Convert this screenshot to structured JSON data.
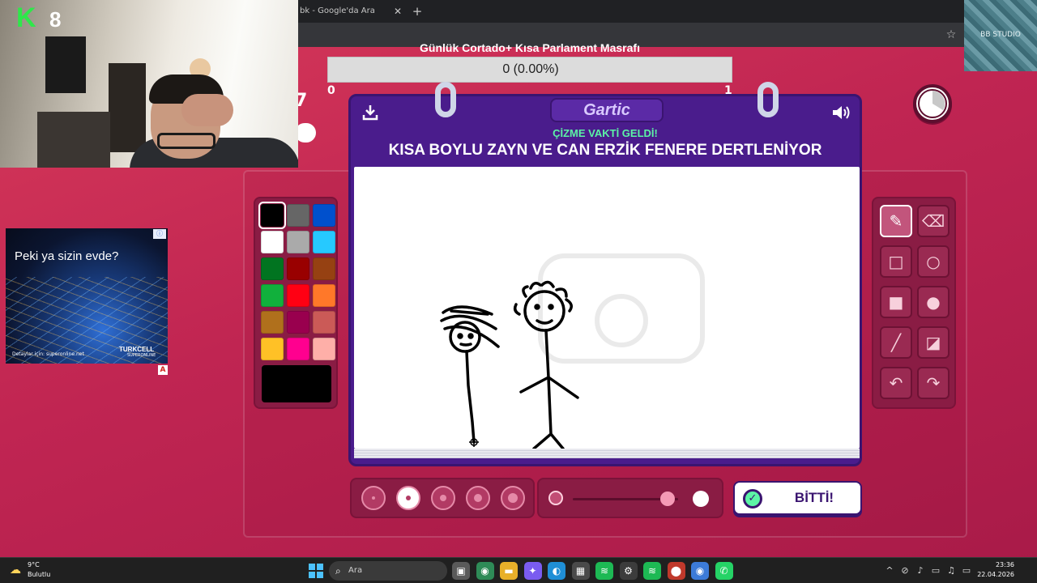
{
  "browser": {
    "tab_title": "bk - Google'da Ara",
    "close_glyph": "✕",
    "new_tab_glyph": "+",
    "star_glyph": "☆"
  },
  "overlay": {
    "k_logo": "K",
    "k_count": "8",
    "watermark": "BB STUDIO"
  },
  "progress": {
    "title": "Günlük Cortado+ Kısa Parlament Masrafı",
    "value_text": "0 (0.00%)",
    "min_label": "0",
    "max_label": "1",
    "fraction": 0
  },
  "game": {
    "brand": "Gartic",
    "subtitle": "ÇİZME VAKTİ GELDİ!",
    "prompt": "KISA BOYLU ZAYN VE CAN ERZİK FENERE DERTLENİYOR",
    "download_icon": "download-icon",
    "sound_icon": "speaker-icon",
    "done_label": "BİTTİ!",
    "done_icon_glyph": "✓",
    "left_digit": "7"
  },
  "palette": {
    "colors": [
      "#000000",
      "#666666",
      "#0050cd",
      "#ffffff",
      "#aaaaaa",
      "#26c9ff",
      "#017420",
      "#990000",
      "#964112",
      "#11b03c",
      "#ff0013",
      "#ff7829",
      "#b0701c",
      "#99004e",
      "#cb5a57",
      "#ffc126",
      "#ff008f",
      "#feafa8"
    ],
    "selected": "#000000",
    "current": "#000000"
  },
  "tools": [
    {
      "name": "pencil-tool",
      "glyph": "✎",
      "active": true
    },
    {
      "name": "eraser-tool",
      "glyph": "⌫",
      "active": false
    },
    {
      "name": "rect-outline-tool",
      "glyph": "□",
      "active": false
    },
    {
      "name": "ellipse-outline-tool",
      "glyph": "○",
      "active": false
    },
    {
      "name": "rect-fill-tool",
      "glyph": "■",
      "active": false
    },
    {
      "name": "ellipse-fill-tool",
      "glyph": "●",
      "active": false
    },
    {
      "name": "line-tool",
      "glyph": "╱",
      "active": false
    },
    {
      "name": "fill-bucket-tool",
      "glyph": "◪",
      "active": false
    },
    {
      "name": "undo-tool",
      "glyph": "↶",
      "active": false
    },
    {
      "name": "redo-tool",
      "glyph": "↷",
      "active": false
    }
  ],
  "brush_sizes": [
    {
      "level": 1,
      "active": false
    },
    {
      "level": 2,
      "active": true
    },
    {
      "level": 3,
      "active": false
    },
    {
      "level": 4,
      "active": false
    },
    {
      "level": 5,
      "active": false
    }
  ],
  "opacity": {
    "value": 0.9
  },
  "ad": {
    "title": "Peki ya sizin evde?",
    "footnote": "Detaylar için: superonline.net",
    "brand": "TURKCELL",
    "brand_sub": "SUPERONLINE",
    "info_glyph": "ⓘ",
    "badge": "A"
  },
  "taskbar": {
    "weather_temp": "9°C",
    "weather_desc": "Bulutlu",
    "search_placeholder": "Ara",
    "time": "23:36",
    "date": "22.04.2026",
    "apps": [
      {
        "name": "task-view-icon",
        "glyph": "▣",
        "color": "#5a5a5a"
      },
      {
        "name": "chrome-icon",
        "glyph": "◉",
        "color": "#2e8b57"
      },
      {
        "name": "file-explorer-icon",
        "glyph": "▬",
        "color": "#e8b02a"
      },
      {
        "name": "copilot-icon",
        "glyph": "✦",
        "color": "#7a5cf0"
      },
      {
        "name": "edge-icon",
        "glyph": "◐",
        "color": "#1f8fd6"
      },
      {
        "name": "store-icon",
        "glyph": "▦",
        "color": "#4a4a4a"
      },
      {
        "name": "spotify-icon",
        "glyph": "≋",
        "color": "#1db954"
      },
      {
        "name": "steam-icon",
        "glyph": "⚙",
        "color": "#3c3c3c"
      },
      {
        "name": "spotify-alt-icon",
        "glyph": "≋",
        "color": "#1db954"
      },
      {
        "name": "recorder-icon",
        "glyph": "⬤",
        "color": "#c0392b"
      },
      {
        "name": "chrome-active-icon",
        "glyph": "◉",
        "color": "#3c7bd8"
      },
      {
        "name": "whatsapp-icon",
        "glyph": "✆",
        "color": "#25d366"
      }
    ],
    "tray": [
      {
        "name": "chevron-up-icon",
        "glyph": "^"
      },
      {
        "name": "meet-icon",
        "glyph": "⊘"
      },
      {
        "name": "microphone-icon",
        "glyph": "♪"
      },
      {
        "name": "monitor-icon",
        "glyph": "▭"
      },
      {
        "name": "speaker-icon",
        "glyph": "♫"
      },
      {
        "name": "battery-icon",
        "glyph": "▭"
      }
    ]
  }
}
